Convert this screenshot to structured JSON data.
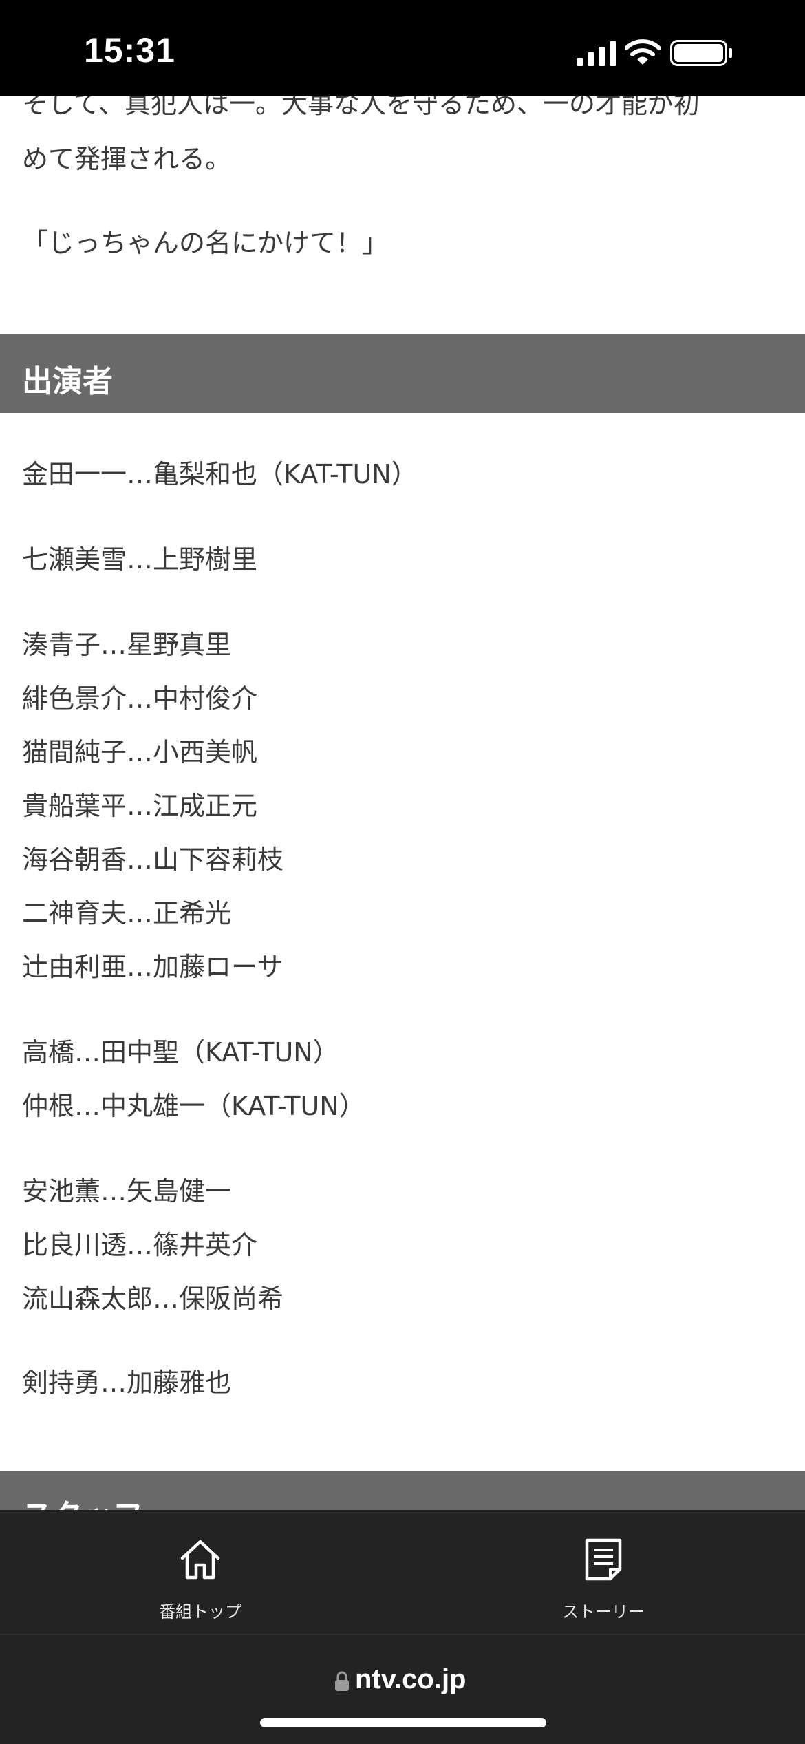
{
  "status_bar": {
    "time": "15:31"
  },
  "intro": {
    "cut_line": "そして、真犯人は一。大事な人を守るため、一の才能が初",
    "line2": "めて発揮される。",
    "quote": "「じっちゃんの名にかけて！」"
  },
  "cast_section": {
    "title": "出演者",
    "groups": [
      [
        "金田一一…亀梨和也（KAT-TUN）"
      ],
      [
        "七瀬美雪…上野樹里"
      ],
      [
        "湊青子…星野真里",
        "緋色景介…中村俊介",
        "猫間純子…小西美帆",
        "貴船葉平…江成正元",
        "海谷朝香…山下容莉枝",
        "二神育夫…正希光",
        "辻由利亜…加藤ローサ"
      ],
      [
        "高橋…田中聖（KAT-TUN）",
        "仲根…中丸雄一（KAT-TUN）"
      ],
      [
        "安池薫…矢島健一",
        "比良川透…篠井英介",
        "流山森太郎…保阪尚希"
      ],
      [
        "剣持勇…加藤雅也"
      ]
    ]
  },
  "staff_section": {
    "title": "スタッフ"
  },
  "tab_bar": {
    "home_label": "番組トップ",
    "story_label": "ストーリー",
    "home_icon": "home-icon",
    "story_icon": "document-icon"
  },
  "url_bar": {
    "domain": "ntv.co.jp",
    "icon": "lock-icon"
  }
}
